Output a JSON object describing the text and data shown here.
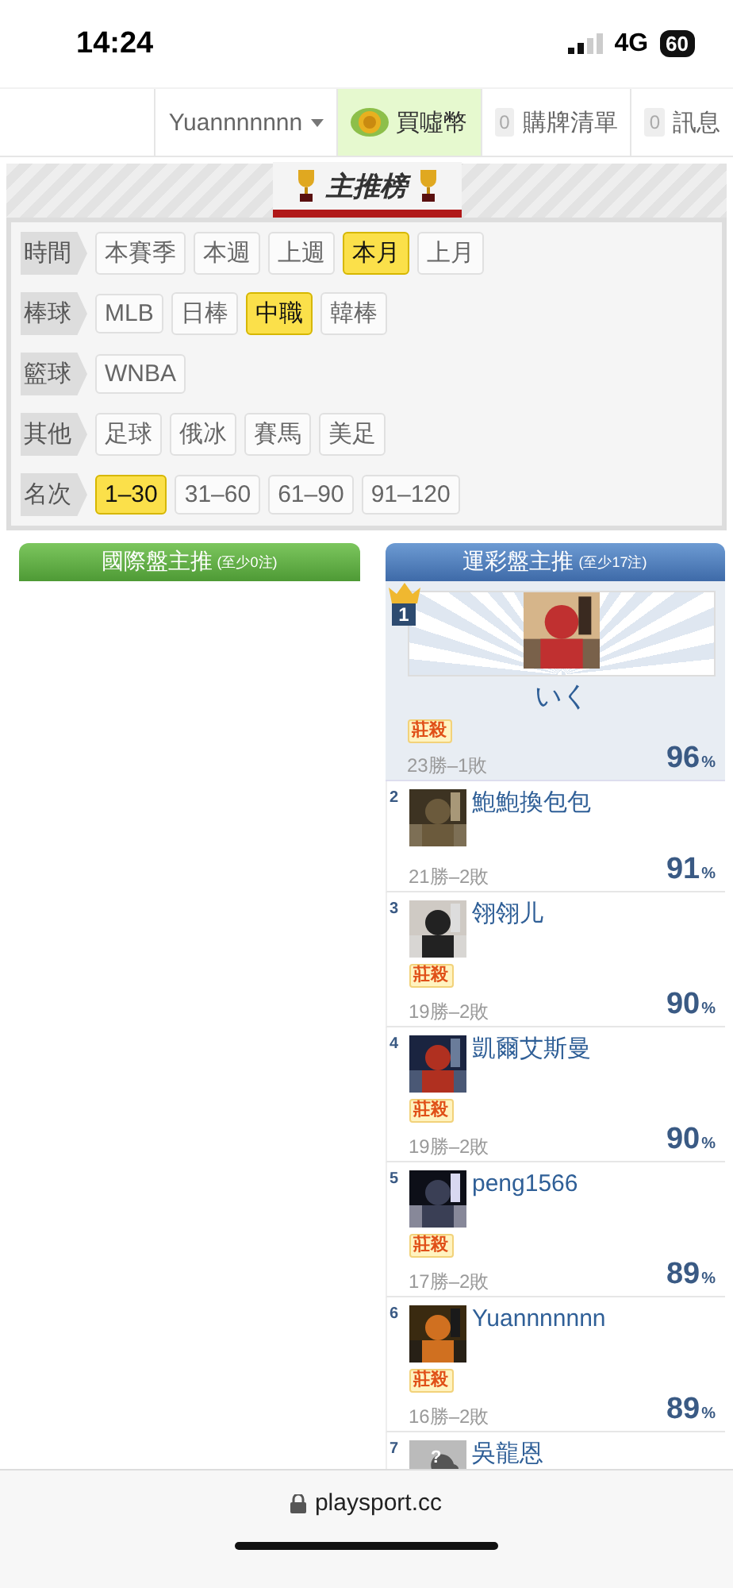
{
  "status_bar": {
    "time": "14:24",
    "network": "4G",
    "battery": "60"
  },
  "nav": {
    "user": "Yuannnnnnn",
    "buy": "買噓幣",
    "links": [
      {
        "count": "0",
        "label": "購牌清單"
      },
      {
        "count": "0",
        "label": "訊息"
      }
    ]
  },
  "banner": {
    "title": "主推榜"
  },
  "filters": [
    {
      "label": "時間",
      "options": [
        {
          "label": "本賽季",
          "selected": false
        },
        {
          "label": "本週",
          "selected": false
        },
        {
          "label": "上週",
          "selected": false
        },
        {
          "label": "本月",
          "selected": true
        },
        {
          "label": "上月",
          "selected": false
        }
      ]
    },
    {
      "label": "棒球",
      "options": [
        {
          "label": "MLB",
          "selected": false
        },
        {
          "label": "日棒",
          "selected": false
        },
        {
          "label": "中職",
          "selected": true
        },
        {
          "label": "韓棒",
          "selected": false
        }
      ]
    },
    {
      "label": "籃球",
      "options": [
        {
          "label": "WNBA",
          "selected": false
        }
      ]
    },
    {
      "label": "其他",
      "options": [
        {
          "label": "足球",
          "selected": false
        },
        {
          "label": "俄冰",
          "selected": false
        },
        {
          "label": "賽馬",
          "selected": false
        },
        {
          "label": "美足",
          "selected": false
        }
      ]
    },
    {
      "label": "名次",
      "options": [
        {
          "label": "1–30",
          "selected": true
        },
        {
          "label": "31–60",
          "selected": false
        },
        {
          "label": "61–90",
          "selected": false
        },
        {
          "label": "91–120",
          "selected": false
        }
      ]
    }
  ],
  "columns": [
    {
      "kind": "green",
      "title": "國際盤主推",
      "note": "(至少0注)"
    },
    {
      "kind": "blue",
      "title": "運彩盤主推",
      "note": "(至少17注)"
    }
  ],
  "leader": {
    "rank": "1",
    "name": "いく",
    "badge": "莊殺",
    "record": "23勝–1敗",
    "rate": "96",
    "unit": "%"
  },
  "rows": [
    {
      "rank": "2",
      "kind": "picture",
      "name": "鮑鮑換包包",
      "record": "21勝–2敗",
      "rate": "91",
      "unit": "%"
    },
    {
      "rank": "3",
      "kind": "picture",
      "name": "翎翎儿",
      "badge": "莊殺",
      "record": "19勝–2敗",
      "rate": "90",
      "unit": "%"
    },
    {
      "rank": "4",
      "kind": "picture",
      "name": "凱爾艾斯曼",
      "badge": "莊殺",
      "record": "19勝–2敗",
      "rate": "90",
      "unit": "%"
    },
    {
      "rank": "5",
      "kind": "picture",
      "name": "peng1566",
      "badge": "莊殺",
      "record": "17勝–2敗",
      "rate": "89",
      "unit": "%"
    },
    {
      "rank": "6",
      "kind": "picture",
      "name": "Yuannnnnnn",
      "badge": "莊殺",
      "record": "16勝–2敗",
      "rate": "89",
      "unit": "%"
    },
    {
      "rank": "7",
      "kind": "placeholder",
      "mark": "?",
      "name": "吳龍恩"
    }
  ],
  "address_bar": {
    "url": "playsport.cc"
  }
}
